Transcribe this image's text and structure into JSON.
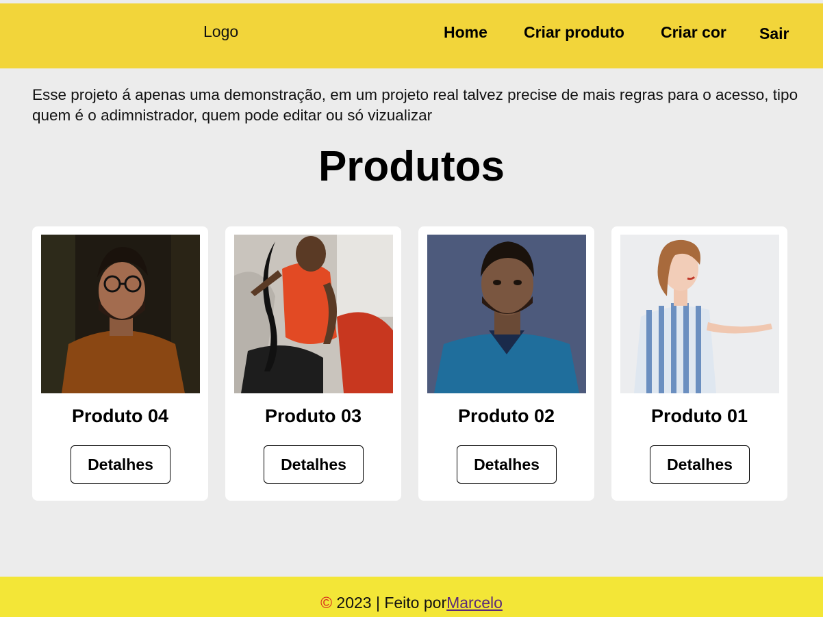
{
  "nav": {
    "logo": "Logo",
    "links": [
      "Home",
      "Criar produto",
      "Criar cor",
      "Sair"
    ]
  },
  "notice": "Esse projeto á apenas uma demonstração, em um projeto real talvez precise de mais regras para o acesso, tipo quem é o adimnistrador, quem pode editar ou só vizualizar",
  "page_title": "Produtos",
  "products": [
    {
      "name": "Produto 04",
      "button": "Detalhes",
      "image": "man-glasses-orange-shirt-photo"
    },
    {
      "name": "Produto 03",
      "button": "Detalhes",
      "image": "woman-red-top-car-photo"
    },
    {
      "name": "Produto 02",
      "button": "Detalhes",
      "image": "man-blue-shirt-photo"
    },
    {
      "name": "Produto 01",
      "button": "Detalhes",
      "image": "woman-striped-dress-photo"
    }
  ],
  "footer": {
    "copyright_symbol": "©",
    "text": " 2023 | Feito por",
    "author_link": "Marcelo"
  },
  "colors": {
    "header": "#f2d53a",
    "footer": "#f3e637",
    "background": "#ececec",
    "card": "#ffffff"
  }
}
